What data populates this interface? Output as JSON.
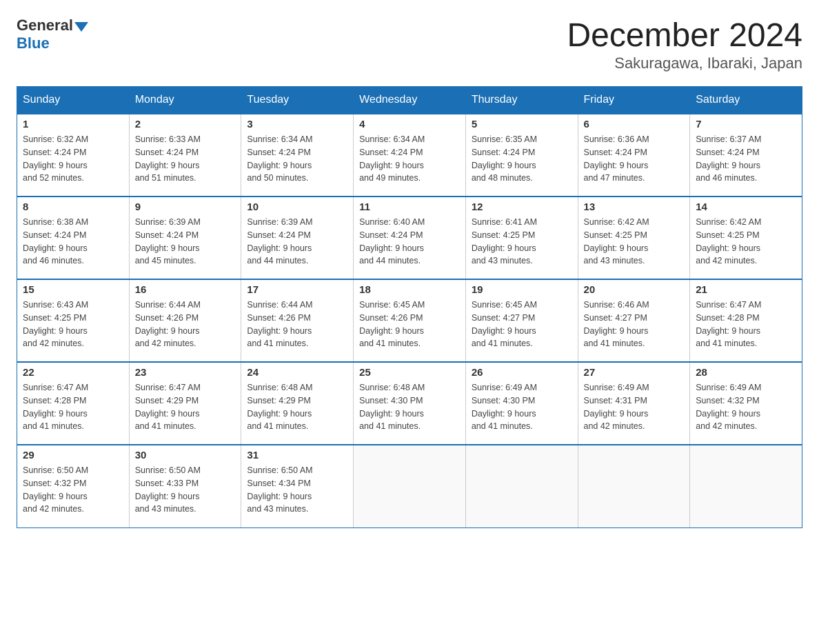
{
  "logo": {
    "general": "General",
    "blue": "Blue"
  },
  "title": "December 2024",
  "subtitle": "Sakuragawa, Ibaraki, Japan",
  "days_of_week": [
    "Sunday",
    "Monday",
    "Tuesday",
    "Wednesday",
    "Thursday",
    "Friday",
    "Saturday"
  ],
  "weeks": [
    [
      {
        "day": "1",
        "sunrise": "6:32 AM",
        "sunset": "4:24 PM",
        "daylight": "9 hours and 52 minutes."
      },
      {
        "day": "2",
        "sunrise": "6:33 AM",
        "sunset": "4:24 PM",
        "daylight": "9 hours and 51 minutes."
      },
      {
        "day": "3",
        "sunrise": "6:34 AM",
        "sunset": "4:24 PM",
        "daylight": "9 hours and 50 minutes."
      },
      {
        "day": "4",
        "sunrise": "6:34 AM",
        "sunset": "4:24 PM",
        "daylight": "9 hours and 49 minutes."
      },
      {
        "day": "5",
        "sunrise": "6:35 AM",
        "sunset": "4:24 PM",
        "daylight": "9 hours and 48 minutes."
      },
      {
        "day": "6",
        "sunrise": "6:36 AM",
        "sunset": "4:24 PM",
        "daylight": "9 hours and 47 minutes."
      },
      {
        "day": "7",
        "sunrise": "6:37 AM",
        "sunset": "4:24 PM",
        "daylight": "9 hours and 46 minutes."
      }
    ],
    [
      {
        "day": "8",
        "sunrise": "6:38 AM",
        "sunset": "4:24 PM",
        "daylight": "9 hours and 46 minutes."
      },
      {
        "day": "9",
        "sunrise": "6:39 AM",
        "sunset": "4:24 PM",
        "daylight": "9 hours and 45 minutes."
      },
      {
        "day": "10",
        "sunrise": "6:39 AM",
        "sunset": "4:24 PM",
        "daylight": "9 hours and 44 minutes."
      },
      {
        "day": "11",
        "sunrise": "6:40 AM",
        "sunset": "4:24 PM",
        "daylight": "9 hours and 44 minutes."
      },
      {
        "day": "12",
        "sunrise": "6:41 AM",
        "sunset": "4:25 PM",
        "daylight": "9 hours and 43 minutes."
      },
      {
        "day": "13",
        "sunrise": "6:42 AM",
        "sunset": "4:25 PM",
        "daylight": "9 hours and 43 minutes."
      },
      {
        "day": "14",
        "sunrise": "6:42 AM",
        "sunset": "4:25 PM",
        "daylight": "9 hours and 42 minutes."
      }
    ],
    [
      {
        "day": "15",
        "sunrise": "6:43 AM",
        "sunset": "4:25 PM",
        "daylight": "9 hours and 42 minutes."
      },
      {
        "day": "16",
        "sunrise": "6:44 AM",
        "sunset": "4:26 PM",
        "daylight": "9 hours and 42 minutes."
      },
      {
        "day": "17",
        "sunrise": "6:44 AM",
        "sunset": "4:26 PM",
        "daylight": "9 hours and 41 minutes."
      },
      {
        "day": "18",
        "sunrise": "6:45 AM",
        "sunset": "4:26 PM",
        "daylight": "9 hours and 41 minutes."
      },
      {
        "day": "19",
        "sunrise": "6:45 AM",
        "sunset": "4:27 PM",
        "daylight": "9 hours and 41 minutes."
      },
      {
        "day": "20",
        "sunrise": "6:46 AM",
        "sunset": "4:27 PM",
        "daylight": "9 hours and 41 minutes."
      },
      {
        "day": "21",
        "sunrise": "6:47 AM",
        "sunset": "4:28 PM",
        "daylight": "9 hours and 41 minutes."
      }
    ],
    [
      {
        "day": "22",
        "sunrise": "6:47 AM",
        "sunset": "4:28 PM",
        "daylight": "9 hours and 41 minutes."
      },
      {
        "day": "23",
        "sunrise": "6:47 AM",
        "sunset": "4:29 PM",
        "daylight": "9 hours and 41 minutes."
      },
      {
        "day": "24",
        "sunrise": "6:48 AM",
        "sunset": "4:29 PM",
        "daylight": "9 hours and 41 minutes."
      },
      {
        "day": "25",
        "sunrise": "6:48 AM",
        "sunset": "4:30 PM",
        "daylight": "9 hours and 41 minutes."
      },
      {
        "day": "26",
        "sunrise": "6:49 AM",
        "sunset": "4:30 PM",
        "daylight": "9 hours and 41 minutes."
      },
      {
        "day": "27",
        "sunrise": "6:49 AM",
        "sunset": "4:31 PM",
        "daylight": "9 hours and 42 minutes."
      },
      {
        "day": "28",
        "sunrise": "6:49 AM",
        "sunset": "4:32 PM",
        "daylight": "9 hours and 42 minutes."
      }
    ],
    [
      {
        "day": "29",
        "sunrise": "6:50 AM",
        "sunset": "4:32 PM",
        "daylight": "9 hours and 42 minutes."
      },
      {
        "day": "30",
        "sunrise": "6:50 AM",
        "sunset": "4:33 PM",
        "daylight": "9 hours and 43 minutes."
      },
      {
        "day": "31",
        "sunrise": "6:50 AM",
        "sunset": "4:34 PM",
        "daylight": "9 hours and 43 minutes."
      },
      null,
      null,
      null,
      null
    ]
  ],
  "labels": {
    "sunrise": "Sunrise:",
    "sunset": "Sunset:",
    "daylight": "Daylight:"
  }
}
